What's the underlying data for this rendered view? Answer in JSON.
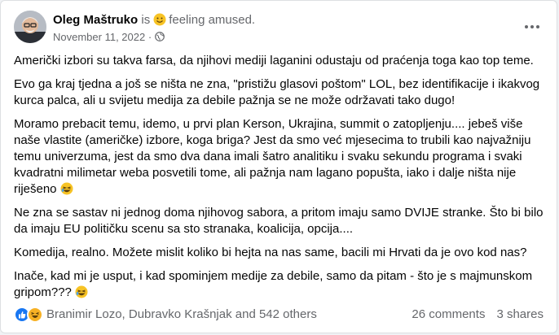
{
  "post": {
    "author": "Oleg Maštruko",
    "is_text": "is",
    "feeling": "feeling amused.",
    "date": "November 11, 2022",
    "dot": "·",
    "paragraphs": [
      "Američki izbori su takva farsa, da njihovi mediji laganini odustaju od praćenja toga kao top teme.",
      "Evo ga kraj tjedna a još se ništa ne zna, \"pristižu glasovi poštom\" LOL, bez identifikacije i ikakvog kurca palca, ali u svijetu medija za debile pažnja se ne može održavati tako dugo!",
      "Moramo prebacit temu, idemo, u prvi plan Kerson, Ukrajina, summit o zatopljenju.... jebeš više naše vlastite (američke) izbore, koga briga? Jest da smo već mjesecima to trubili kao najvažniju temu univerzuma, jest da smo dva dana imali šatro analitiku i svaku sekundu programa i svaki kvadratni milimetar weba posvetili tome, ali pažnja nam lagano popušta, iako i dalje ništa nije riješeno",
      "Ne zna se sastav ni jednog doma njihovog sabora, a pritom imaju samo DVIJE stranke. Što bi bilo da imaju EU političku scenu sa sto stranaka, koalicija, opcija....",
      "Komedija, realno. Možete mislit koliko bi hejta na nas same, bacili mi Hrvati da je ovo kod nas?",
      "Inače, kad mi je usput, i kad spominjem medije za debile, samo da pitam - što je s majmunskom gripom???"
    ]
  },
  "footer": {
    "reactors": "Branimir Lozo, Dubravko Krašnjak and 542 others",
    "comments": "26 comments",
    "shares": "3 shares"
  },
  "colors": {
    "like": "#1877f2",
    "haha": "#f7b125",
    "text_secondary": "#65676b"
  },
  "icons": [
    "avatar",
    "smile-emoji-icon",
    "globe-icon",
    "more-options-icon",
    "laughing-emoji-icon",
    "like-reaction-icon",
    "haha-reaction-icon"
  ]
}
